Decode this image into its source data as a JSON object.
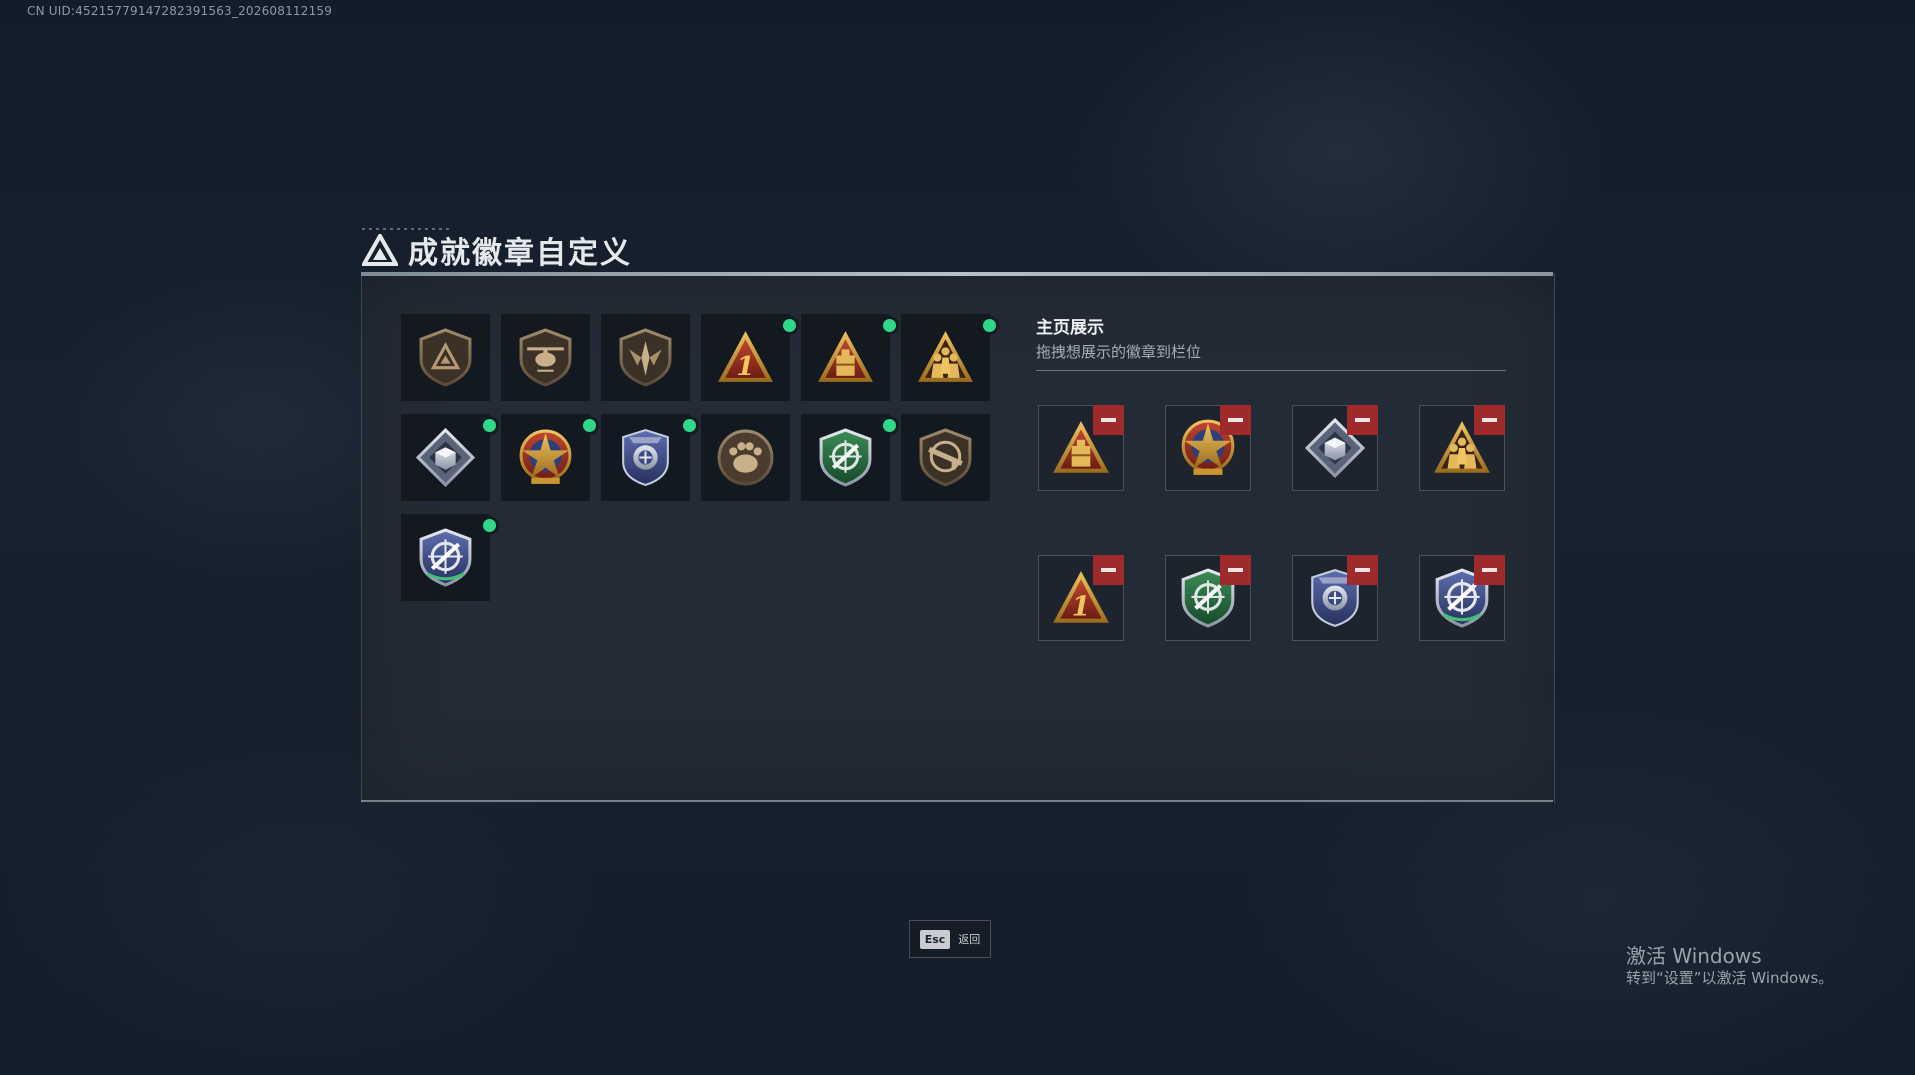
{
  "uid_text": "CN UID:452157791472823915​63_202608112159",
  "header": {
    "title": "成就徽章自定义",
    "icon": "triangle-logo-icon"
  },
  "collection": {
    "badges": [
      {
        "name": "shield-triangle-badge",
        "active": false
      },
      {
        "name": "helicopter-shield-badge",
        "active": false
      },
      {
        "name": "dagger-shield-badge",
        "active": false
      },
      {
        "name": "number-one-triangle-badge",
        "active": true
      },
      {
        "name": "crate-triangle-badge",
        "active": true
      },
      {
        "name": "soldiers-triangle-badge",
        "active": true
      },
      {
        "name": "diamond-cube-badge",
        "active": true
      },
      {
        "name": "star-medal-badge",
        "active": true
      },
      {
        "name": "police-shield-badge",
        "active": true
      },
      {
        "name": "bear-paw-badge",
        "active": false
      },
      {
        "name": "green-crosshair-shield-badge",
        "active": true
      },
      {
        "name": "rifle-shield-badge",
        "active": false
      },
      {
        "name": "blue-crosshair-shield-badge",
        "active": true
      }
    ]
  },
  "showcase": {
    "title": "主页展示",
    "subtitle": "拖拽想展示的徽章到栏位",
    "slots": [
      {
        "name": "crate-triangle-badge"
      },
      {
        "name": "star-medal-badge"
      },
      {
        "name": "diamond-cube-badge"
      },
      {
        "name": "soldiers-triangle-badge"
      },
      {
        "name": "number-one-triangle-badge"
      },
      {
        "name": "green-crosshair-shield-badge"
      },
      {
        "name": "police-shield-badge"
      },
      {
        "name": "blue-crosshair-shield-badge"
      }
    ]
  },
  "footer": {
    "esc_key": "Esc",
    "esc_label": "返回"
  },
  "watermark": {
    "line1": "激活 Windows",
    "line2": "转到“设置”以激活 Windows。"
  },
  "colors": {
    "active_dot": "#2fd889",
    "remove_button": "#9e2a2c",
    "gold": "#c8952e"
  }
}
